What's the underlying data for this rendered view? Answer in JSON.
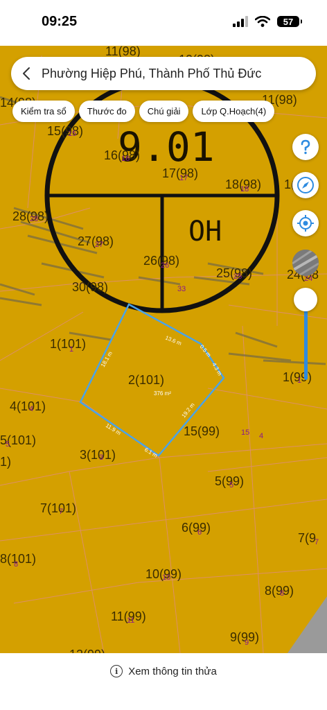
{
  "status_bar": {
    "time": "09:25",
    "battery": "57"
  },
  "search": {
    "location": "Phường Hiệp Phú, Thành Phố Thủ Đức"
  },
  "chips": [
    {
      "label": "Kiểm tra sổ"
    },
    {
      "label": "Thước đo"
    },
    {
      "label": "Chú giải"
    },
    {
      "label": "Lớp Q.Hoạch(4)"
    }
  ],
  "map": {
    "zone_code": "9.01",
    "zone_type": "OH",
    "parcel_labels": [
      "11(98)",
      "10(98)",
      "14(98)",
      "11(98)",
      "15(98)",
      "16(98)",
      "17(98)",
      "18(98)",
      "1(9",
      "28(98)",
      "27(98)",
      "26(98)",
      "25(98)",
      "24(98",
      "30(98)",
      "1(101)",
      "2(101)",
      "4(101)",
      "1(99)",
      "5(101)",
      "1)",
      "3(101)",
      "15(99)",
      "5(99)",
      "7(101)",
      "6(99)",
      "7(9",
      "8(101)",
      "10(99)",
      "8(99)",
      "11(99)",
      "9(99)",
      "12(99)"
    ],
    "sheet_numbers": [
      "15",
      "16",
      "17",
      "18",
      "28",
      "27",
      "26",
      "25",
      "24",
      "33",
      "1",
      "4",
      "5",
      "3",
      "15",
      "4",
      "5",
      "7",
      "6",
      "7",
      "8",
      "10",
      "8",
      "11",
      "9",
      "1"
    ],
    "selected_parcel": {
      "area": "376 m²",
      "edges": [
        "13.6 m",
        "0.5 m",
        "4.3 m",
        "19.2 m",
        "6.1 m",
        "11.9 m",
        "18.1 m"
      ]
    },
    "zoom_level": 0.72
  },
  "bottom": {
    "info_label": "Xem thông tin thửa"
  },
  "colors": {
    "map_bg": "#d4a000",
    "accent": "#2e8be0",
    "parcel_outline": "#4aa3e8"
  }
}
